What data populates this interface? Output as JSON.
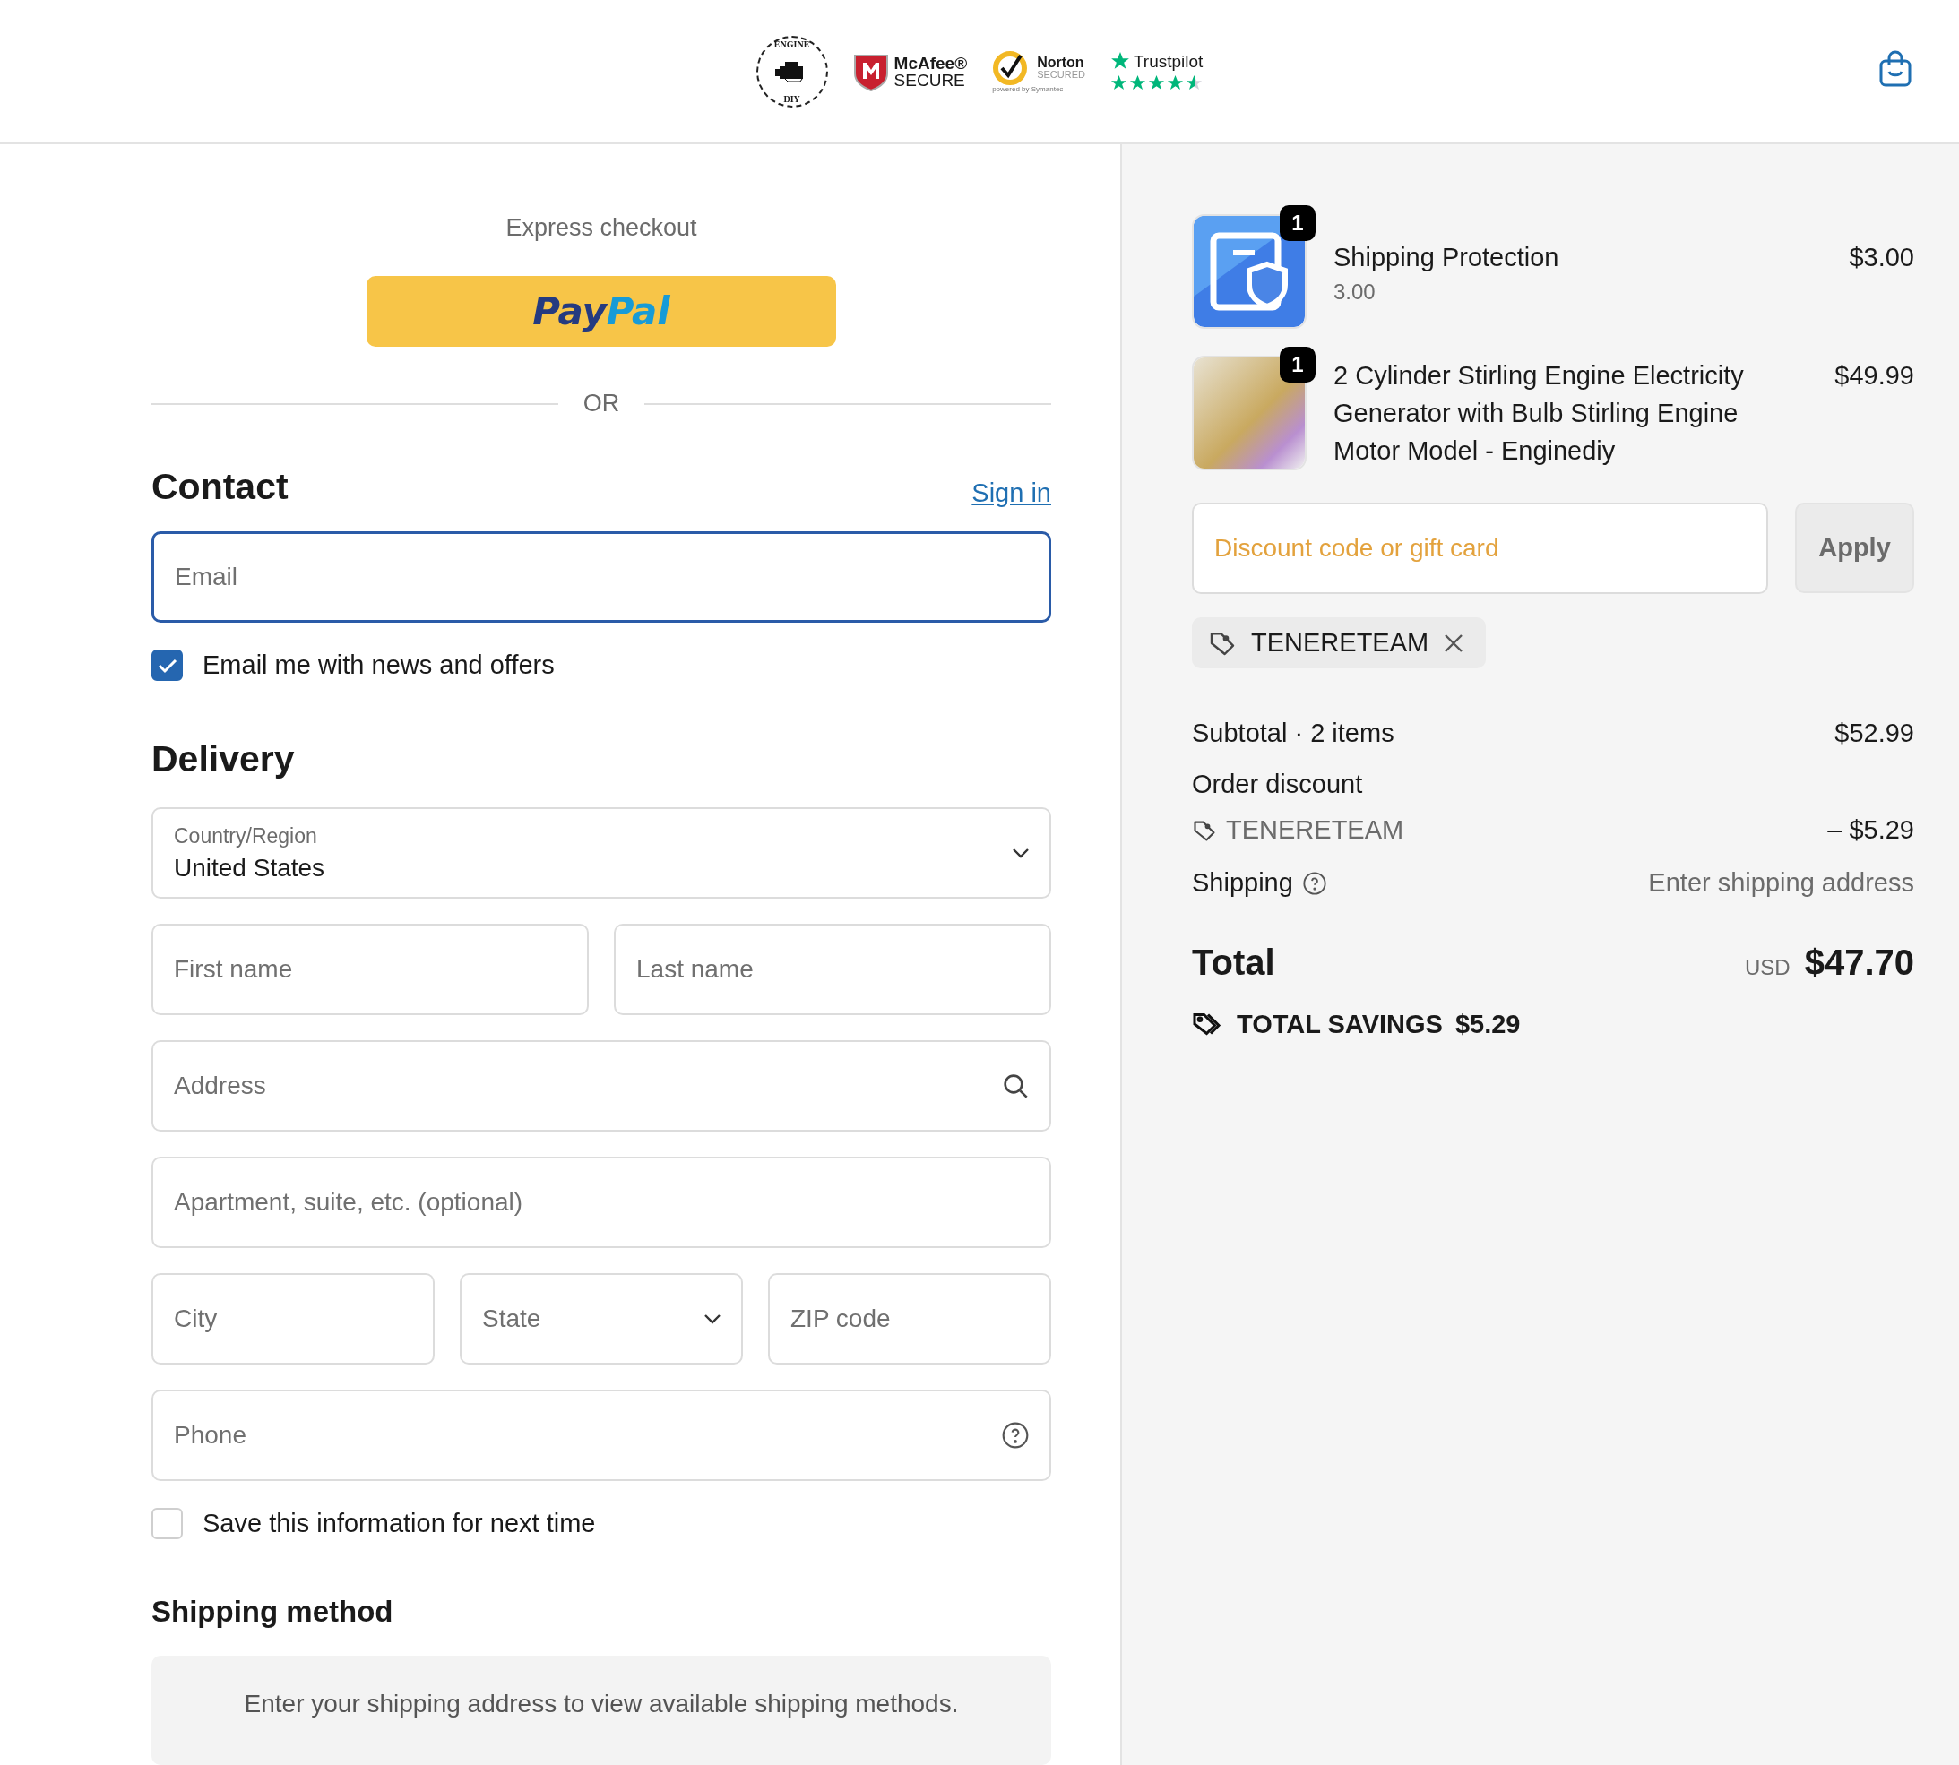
{
  "header": {
    "badges": [
      {
        "kind": "engine",
        "top": "ENGINE",
        "bottom": "DIY"
      },
      {
        "kind": "mcafee",
        "name": "McAfee®",
        "tag": "SECURE"
      },
      {
        "kind": "norton",
        "name": "Norton",
        "tag": "SECURED",
        "sub": "powered by Symantec"
      },
      {
        "kind": "trustpilot",
        "name": "Trustpilot",
        "stars": 4.5
      }
    ]
  },
  "express": {
    "title": "Express checkout",
    "paypal": [
      "Pay",
      "Pal"
    ],
    "divider": "OR"
  },
  "contact": {
    "title": "Contact",
    "sign_in": "Sign in",
    "email": {
      "placeholder": "Email",
      "focused": true
    },
    "news": {
      "label": "Email me with news and offers",
      "checked": true
    }
  },
  "delivery": {
    "title": "Delivery",
    "rows": [
      {
        "fields": [
          {
            "kind": "select",
            "label": "Country/Region",
            "value": "United States"
          }
        ]
      },
      {
        "fields": [
          {
            "kind": "text",
            "placeholder": "First name"
          },
          {
            "kind": "text",
            "placeholder": "Last name"
          }
        ]
      },
      {
        "fields": [
          {
            "kind": "search",
            "placeholder": "Address"
          }
        ]
      },
      {
        "fields": [
          {
            "kind": "text",
            "placeholder": "Apartment, suite, etc. (optional)"
          }
        ]
      },
      {
        "fields": [
          {
            "kind": "text",
            "placeholder": "City"
          },
          {
            "kind": "select",
            "placeholder": "State"
          },
          {
            "kind": "text",
            "placeholder": "ZIP code"
          }
        ]
      },
      {
        "fields": [
          {
            "kind": "help",
            "placeholder": "Phone"
          }
        ]
      }
    ],
    "save": {
      "label": "Save this information for next time",
      "checked": false
    }
  },
  "shipping_method": {
    "title": "Shipping method",
    "notice": "Enter your shipping address to view available shipping methods."
  },
  "summary": {
    "items": [
      {
        "kind": "shield",
        "quantity": "1",
        "name": "Shipping Protection",
        "variant": "3.00",
        "price": "$3.00"
      },
      {
        "kind": "photo",
        "quantity": "1",
        "name": "2 Cylinder Stirling Engine Electricity Generator with Bulb Stirling Engine Motor Model - Enginediy",
        "price": "$49.99"
      }
    ],
    "discount": {
      "placeholder": "Discount code or gift card",
      "button": "Apply",
      "code": "TENERETEAM"
    },
    "subtotal": {
      "label": "Subtotal · 2 items",
      "value": "$52.99"
    },
    "order_discount": {
      "label": "Order discount",
      "code": "TENERETEAM",
      "value": "– $5.29"
    },
    "shipping": {
      "label": "Shipping",
      "value": "Enter shipping address"
    },
    "total": {
      "label": "Total",
      "currency": "USD",
      "value": "$47.70"
    },
    "savings": {
      "label": "TOTAL SAVINGS",
      "value": "$5.29"
    }
  }
}
